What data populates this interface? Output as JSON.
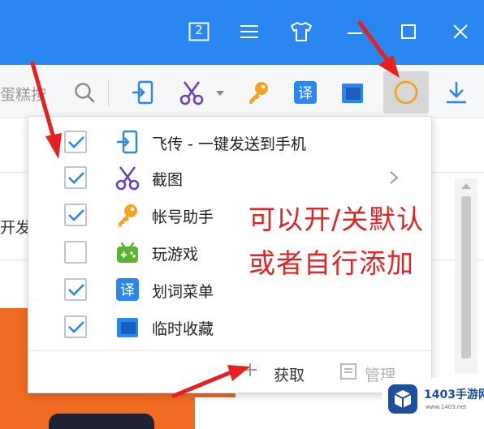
{
  "titlebar": {
    "window_count": "2",
    "buttons": [
      "window-count",
      "menu",
      "skin",
      "minimize",
      "maximize",
      "close"
    ]
  },
  "toolbar": {
    "search_fragment": "蛋糕按",
    "tools": [
      "feichuan-send-icon",
      "screenshot-scissors-icon",
      "account-key-icon",
      "translate-icon",
      "favorites-icon",
      "game-circle-icon",
      "download-icon"
    ]
  },
  "page": {
    "fragment_text": "开发"
  },
  "dropdown": {
    "items": [
      {
        "label": "飞传 - 一键发送到手机",
        "checked": true,
        "icon": "feichuan-send-icon",
        "has_submenu": false
      },
      {
        "label": "截图",
        "checked": true,
        "icon": "scissors-icon",
        "has_submenu": true
      },
      {
        "label": "帐号助手",
        "checked": true,
        "icon": "key-icon",
        "has_submenu": false
      },
      {
        "label": "玩游戏",
        "checked": false,
        "icon": "gamepad-icon",
        "has_submenu": false
      },
      {
        "label": "划词菜单",
        "checked": true,
        "icon": "translate-icon",
        "has_submenu": false
      },
      {
        "label": "临时收藏",
        "checked": true,
        "icon": "favorites-icon",
        "has_submenu": false
      }
    ],
    "footer": {
      "get_label": "获取",
      "manage_label": "管理"
    }
  },
  "annotation": {
    "line1": "可以开/关默认",
    "line2": "或者自行添加"
  },
  "watermark": {
    "text": "1403手游网",
    "sub": "www.1403.net"
  },
  "colors": {
    "titlebar": "#2a86f0",
    "accent_blue": "#2a86f0",
    "annotation_red": "#e52222",
    "arrow_red": "#e5201f",
    "orange": "#f26b22"
  }
}
